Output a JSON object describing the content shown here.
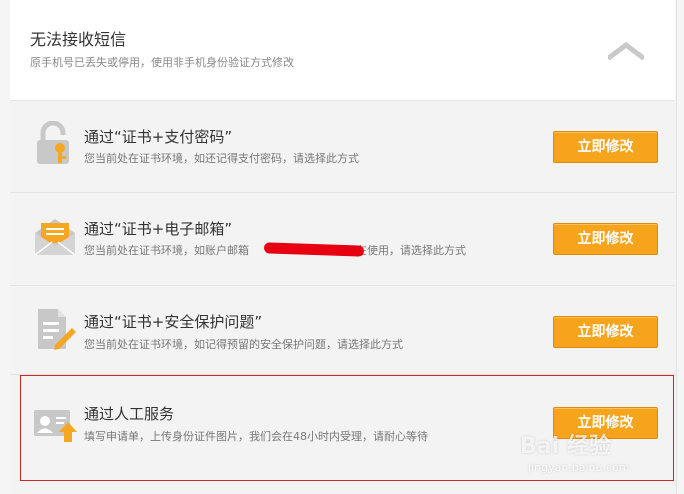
{
  "header": {
    "title": "无法接收短信",
    "subtitle": "原手机号已丢失或停用，使用非手机身份验证方式修改",
    "collapse_icon": "chevron-up-icon"
  },
  "options": [
    {
      "title": "通过“证书+支付密码”",
      "description": "您当前处在证书环境，如还记得支付密码，请选择此方式",
      "button": "立即修改",
      "icon": "lock-key-icon"
    },
    {
      "title": "通过“证书+电子邮箱”",
      "description_before": "您当前处在证书环境，如账户邮箱",
      "description_after": "还在使用，请选择此方式",
      "button": "立即修改",
      "icon": "email-icon"
    },
    {
      "title": "通过“证书+安全保护问题”",
      "description": "您当前处在证书环境，如记得预留的安全保护问题，请选择此方式",
      "button": "立即修改",
      "icon": "document-pencil-icon"
    },
    {
      "title": "通过人工服务",
      "description": "填写申请单，上传身份证件图片，我们会在48小时内受理，请耐心等待",
      "button": "立即修改",
      "icon": "id-card-upload-icon"
    }
  ],
  "watermark": {
    "text": "Bai 经验",
    "url": "jingyan.baidu.com"
  },
  "colors": {
    "button": "#f7a41d",
    "highlight": "#d02626",
    "icon": "#c8c8c8",
    "accent": "#f5a623"
  }
}
